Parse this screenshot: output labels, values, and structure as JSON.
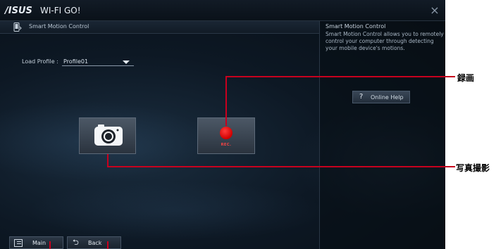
{
  "window": {
    "brand": "/ISUS",
    "title": "WI-FI GO!",
    "close_icon": "×"
  },
  "section": {
    "title": "Smart Motion Control"
  },
  "profile": {
    "label": "Load Profile :",
    "value": "Profile01"
  },
  "buttons": {
    "camera": {
      "icon": "camera-icon"
    },
    "record": {
      "icon": "record-icon",
      "label": "REC."
    }
  },
  "info_panel": {
    "title": "Smart Motion Control",
    "text": "Smart Motion Control allows you to remotely control your computer through detecting your mobile device's motions.",
    "help_label": "Online Help",
    "help_icon": "?"
  },
  "footer": {
    "main_label": "Main",
    "back_label": "Back",
    "back_icon": "⮌"
  },
  "callouts": {
    "record": "録画",
    "photo": "写真撮影"
  },
  "colors": {
    "callout_red": "#c8001e",
    "record_red": "#d00000"
  }
}
